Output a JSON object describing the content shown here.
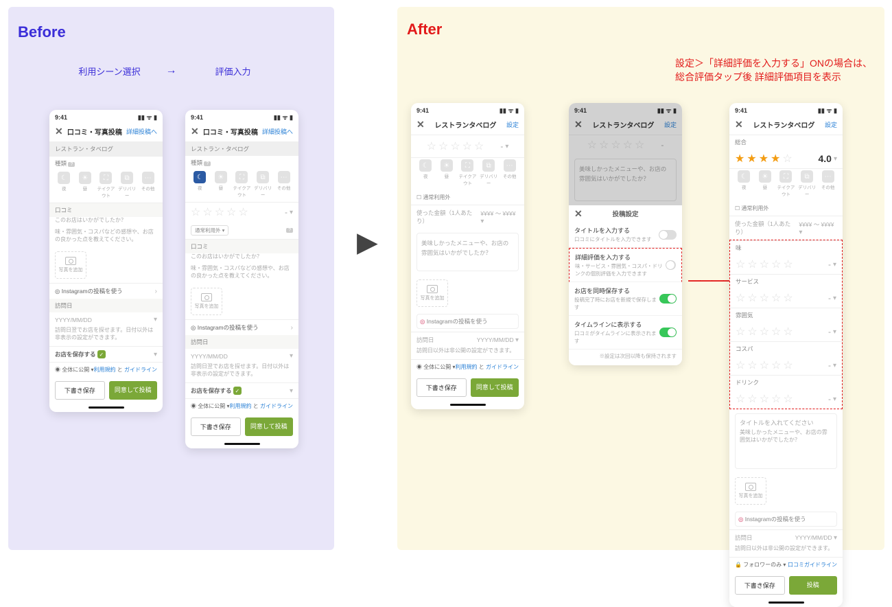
{
  "panels": {
    "before": {
      "title": "Before",
      "step1": "利用シーン選択",
      "arrow": "→",
      "step2": "評価入力"
    },
    "after": {
      "title": "After"
    }
  },
  "callout": {
    "line1": "設定＞「詳細評価を入力する」ONの場合は、",
    "line2": "総合評価タップ後 詳細評価項目を表示"
  },
  "status": {
    "time": "9:41"
  },
  "nav": {
    "close": "✕",
    "title_post": "口コミ・写真投稿",
    "right_detail_post": "詳細投稿へ",
    "title_restaurant": "レストランタベログ",
    "right_settings": "設定"
  },
  "phoneA": {
    "subtitle": "レストラン・タベログ",
    "kindLabel": "種類",
    "scenes": [
      "夜",
      "昼",
      "テイクアウト",
      "デリバリー",
      "その他"
    ],
    "reviewLabel": "口コミ",
    "placeholder1": "このお店はいかがでしたか？",
    "placeholder2": "味・雰囲気・コスパなどの感想や、お店の良かった点を教えてください。",
    "photoCap": "写真を追加",
    "igLabel": "Instagramの投稿を使う",
    "visitDateLabel": "訪問日",
    "datePh": "YYYY/MM/DD",
    "dateHelp": "訪問日翌でお店を探せます。日付以外は非表示の設定ができます。",
    "saveStoreLabel": "お店を保存する",
    "visibilityLabel": "全体に公開",
    "termsText": "利用規約",
    "joiner": " と ",
    "guideText": "ガイドライン",
    "btnDraft": "下書き保存",
    "btnSubmit": "同意して投稿"
  },
  "phoneB": {
    "usagePill": "通常利用外"
  },
  "phoneC": {
    "textareaPh": "美味しかったメニューや、お店の雰囲気はいかがでしたか？",
    "amountLabel": "使った金額（1人あたり）",
    "amountValue": "¥¥¥¥ ～ ¥¥¥¥",
    "dateInline": "YYYY/MM/DD",
    "dateHelp": "訪問日以外は非公開の設定ができます。",
    "usagePill": "通常利用外",
    "starDash": "-"
  },
  "sheet": {
    "title": "投稿設定",
    "r1": {
      "main": "タイトルを入力する",
      "sub": "口コミにタイトルを入力できます"
    },
    "r2": {
      "main": "詳細評価を入力する",
      "sub": "味・サービス・雰囲気・コスパ・ドリンクの個別評価を入力できます"
    },
    "r3": {
      "main": "お店を同時保存する",
      "sub": "投稿完了時にお店を新規で保存します"
    },
    "r4": {
      "main": "タイムラインに表示する",
      "sub": "口コミがタイムラインに表示されます"
    },
    "footnote": "※設定は次回以降も保持されます"
  },
  "phoneE": {
    "overall": "総合",
    "score": "4.0",
    "detail": {
      "taste": "味",
      "service": "サービス",
      "atmosphere": "雰囲気",
      "cospa": "コスパ",
      "drink": "ドリンク",
      "dash": "-"
    },
    "titlePh": "タイトルを入れてください",
    "bodyPh": "美味しかったメニューや、お店の雰囲気はいかがでしたか？",
    "followerOnly": "フォロワーのみ",
    "guideLabel": "口コミガイドライン",
    "btnDraft": "下書き保存",
    "btnSubmit": "投稿"
  }
}
